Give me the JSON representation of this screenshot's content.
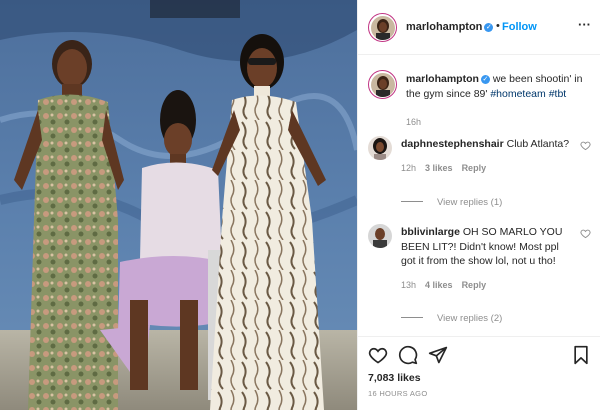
{
  "header": {
    "username": "marlohampton",
    "verified_glyph": "✓",
    "separator": "•",
    "follow_label": "Follow",
    "more_icon": "more-horizontal-icon",
    "more_glyph": "···"
  },
  "caption": {
    "username": "marlohampton",
    "verified_glyph": "✓",
    "text": " we been shootin' in the gym since 89' ",
    "hashtag1": "#hometeam",
    "hashtag2": "#tbt",
    "time": "16h"
  },
  "comments": [
    {
      "username": "daphnestephenshair",
      "text": " Club Atlanta?",
      "time": "12h",
      "likes": "3 likes",
      "reply_label": "Reply",
      "view_replies": "View replies (1)"
    },
    {
      "username": "bblivinlarge",
      "text": " OH SO MARLO YOU BEEN LIT?! Didn't know! Most ppl got it from the show lol, not u tho!",
      "time": "13h",
      "likes": "4 likes",
      "reply_label": "Reply",
      "view_replies": "View replies (2)"
    }
  ],
  "actions": {
    "icons": [
      "heart-icon",
      "comment-icon",
      "share-icon",
      "bookmark-icon"
    ],
    "likes_count": "7,083 likes",
    "posted_ago": "16 HOURS AGO"
  },
  "colors": {
    "link_blue": "#0095f6",
    "hashtag_blue": "#00376b",
    "muted_gray": "#8e8e8e",
    "text_dark": "#262626",
    "verified_blue": "#3897f0"
  }
}
